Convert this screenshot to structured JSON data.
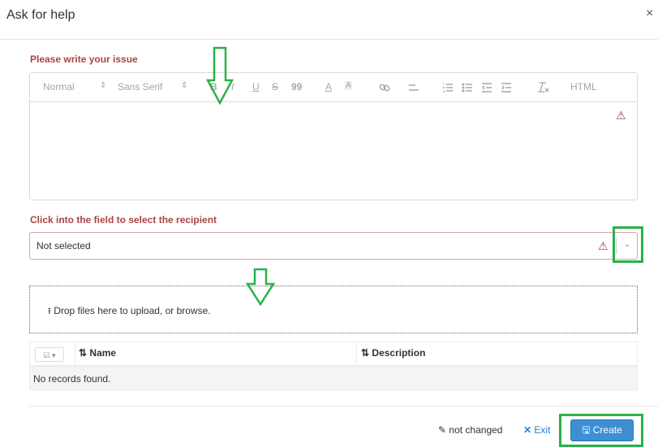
{
  "dialog": {
    "title": "Ask for help",
    "close_glyph": "×"
  },
  "issue": {
    "label": "Please write your issue",
    "toolbar": {
      "header_select": "Normal",
      "font_select": "Sans Serif",
      "bold": "B",
      "italic": "I",
      "underline": "U",
      "strike": "S",
      "quote": "99",
      "font_color": "A",
      "background_color": "A",
      "html": "HTML"
    },
    "warning_glyph": "⚠"
  },
  "recipient": {
    "label": "Click into the field to select the recipient",
    "value": "Not selected",
    "warning_glyph": "⚠",
    "chevron_glyph": "⌄"
  },
  "upload": {
    "text": "Drop files here to upload, or browse.",
    "icon": "upload-icon"
  },
  "files_table": {
    "columns": [
      "Name",
      "Description"
    ],
    "sort_glyph": "⇅",
    "empty_text": "No records found."
  },
  "footer": {
    "status": "not changed",
    "exit_label": "Exit",
    "create_label": "Create"
  },
  "colors": {
    "error": "#a94442",
    "primary": "#3c8fd3",
    "highlight": "#2ab24a",
    "link": "#2f7bd6"
  }
}
